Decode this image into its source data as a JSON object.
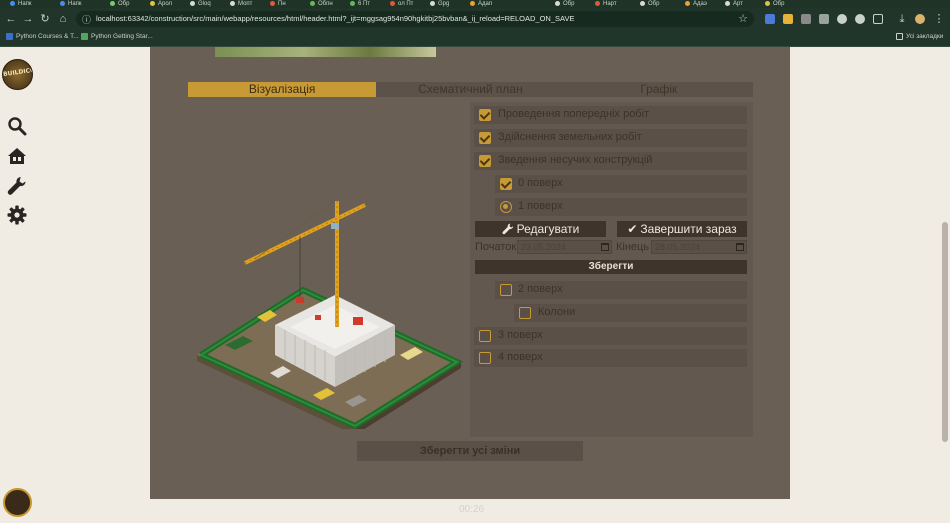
{
  "browser": {
    "tabs": [
      "Напк",
      "Напк",
      "Обр",
      "Арол",
      "Gloq",
      "Мопт",
      "Пн",
      "Обпн",
      "6 Пт",
      "ол Пт",
      "Gpg",
      "Адап",
      "Обр",
      "Нарт",
      "Обр",
      "Адаэ",
      "Арт",
      "Обр"
    ],
    "url": "localhost:63342/construction/src/main/webapp/resources/html/header.html?_ijt=mggsag954n90hgkitbj25bvban&_ij_reload=RELOAD_ON_SAVE",
    "bookmarks": [
      "Python Courses & T...",
      "Python Getting Star..."
    ],
    "bookmarks_folder": "Усі закладки"
  },
  "sidebar": {
    "logo_text": "BUILDICO",
    "icons": [
      "search-icon",
      "home-icon",
      "wrench-icon",
      "gear-icon"
    ]
  },
  "tabs": [
    {
      "label": "Візуалізація",
      "active": true
    },
    {
      "label": "Схематичний план",
      "active": false
    },
    {
      "label": "Графік",
      "active": false
    }
  ],
  "stages": [
    {
      "label": "Проведення попередніх робіт",
      "checked": true
    },
    {
      "label": "Здійснення земельних робіт",
      "checked": true
    },
    {
      "label": "Зведення несучих конструкцій",
      "checked": true
    },
    {
      "label": "0 поверх",
      "checked": true
    },
    {
      "label": "1 поверх",
      "radio": true
    }
  ],
  "actions": {
    "edit_label": "Редагувати",
    "finish_label": "Завершити зараз"
  },
  "dates": {
    "start_label": "Початок",
    "start_value": "23.05.2024",
    "end_label": "Кінець",
    "end_value": "28.05.2024",
    "save_label": "Зберегти"
  },
  "pending": [
    {
      "label": "2 поверх",
      "checked": false
    },
    {
      "label": "Колони",
      "checked": false
    },
    {
      "label": "3 поверх",
      "checked": false
    },
    {
      "label": "4 поверх",
      "checked": false
    }
  ],
  "save_all_label": "Зберегти усі зміни",
  "timer": "00:26",
  "colors": {
    "accent": "#c79a36",
    "panel": "#6a5f55",
    "dark_button": "#3e342b"
  }
}
